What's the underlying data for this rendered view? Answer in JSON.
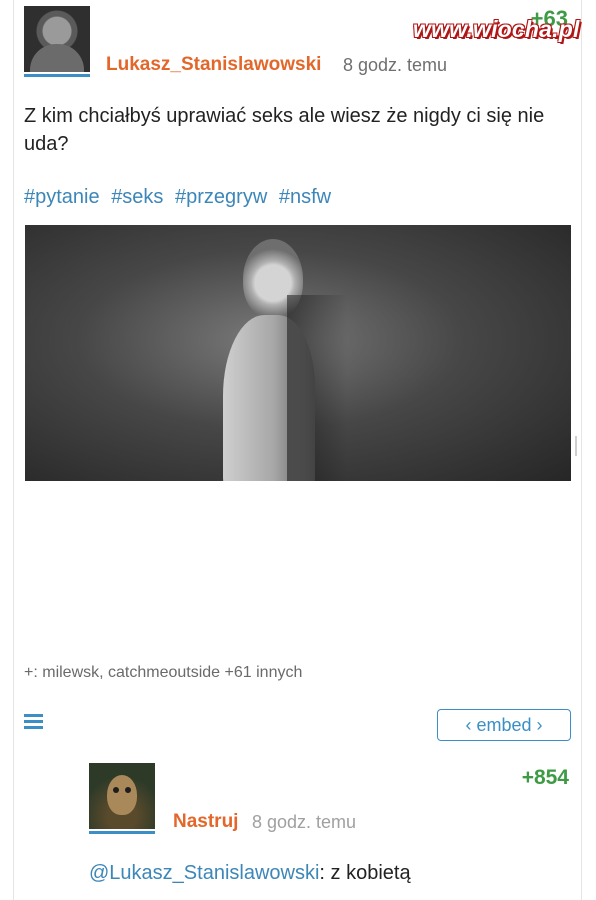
{
  "post": {
    "username": "Lukasz_Stanislawowski",
    "time_ago": "8 godz. temu",
    "vote_count": "+63",
    "text": "Z kim chciałbyś uprawiać seks ale wiesz że nigdy ci się nie uda?",
    "tags": [
      "#pytanie",
      "#seks",
      "#przegryw",
      "#nsfw"
    ],
    "plus_users": "+: milewsk, catchmeoutside +61 innych",
    "embed_label": "‹ embed ›"
  },
  "watermark": "www.wiocha.pl",
  "comment": {
    "username": "Nastruj",
    "time_ago": "8 godz. temu",
    "vote_count": "+854",
    "mention": "@Lukasz_Stanislawowski",
    "text": ": z kobietą"
  },
  "colors": {
    "accent_blue": "#3b8fc4",
    "username_orange": "#e3672a",
    "vote_green": "#3f9a45"
  },
  "icons": {
    "menu": "hamburger-icon"
  }
}
